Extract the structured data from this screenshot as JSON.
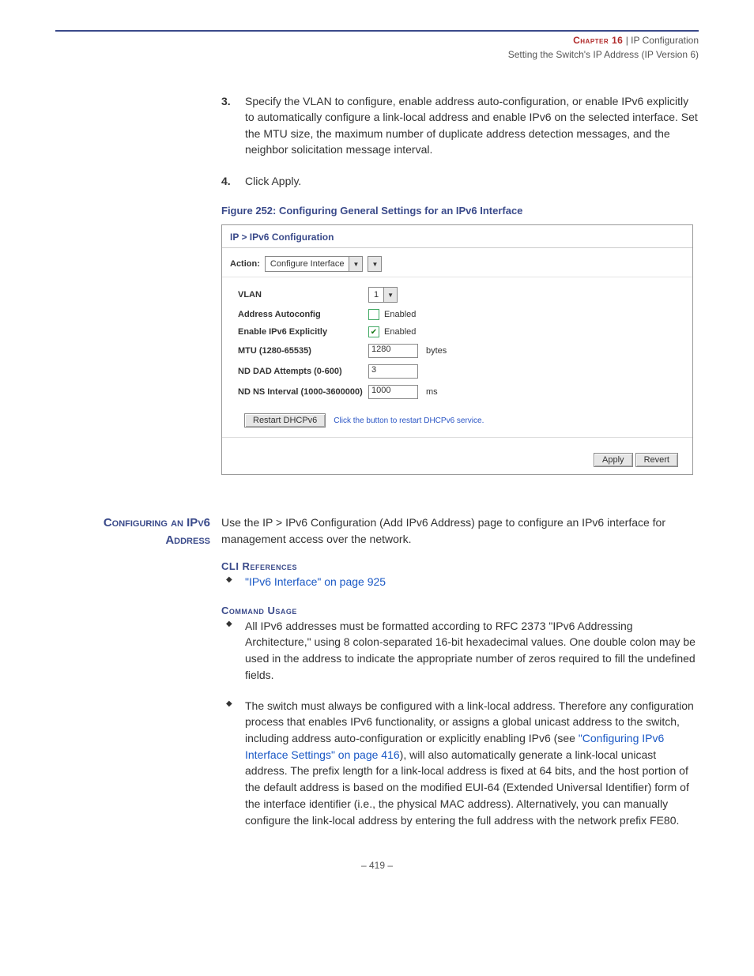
{
  "header": {
    "chapter_label": "Chapter 16",
    "separator": "  |  ",
    "chapter_title": "IP Configuration",
    "subtitle": "Setting the Switch's IP Address (IP Version 6)"
  },
  "steps": {
    "s3_num": "3.",
    "s3_text": "Specify the VLAN to configure, enable address auto-configuration, or enable IPv6 explicitly to automatically configure a link-local address and enable IPv6 on the selected interface. Set the MTU size, the maximum number of duplicate address detection messages, and the neighbor solicitation message interval.",
    "s4_num": "4.",
    "s4_text": "Click Apply."
  },
  "figure_caption": "Figure 252:  Configuring General Settings for an IPv6 Interface",
  "screenshot": {
    "title": "IP > IPv6 Configuration",
    "action_label": "Action:",
    "action_value": "Configure Interface",
    "fields": {
      "vlan_label": "VLAN",
      "vlan_value": "1",
      "autoconfig_label": "Address Autoconfig",
      "autoconfig_cb_label": "Enabled",
      "explicit_label": "Enable IPv6 Explicitly",
      "explicit_cb_label": "Enabled",
      "mtu_label": "MTU (1280-65535)",
      "mtu_value": "1280",
      "mtu_unit": "bytes",
      "dad_label": "ND DAD Attempts (0-600)",
      "dad_value": "3",
      "ns_label": "ND NS Interval (1000-3600000)",
      "ns_value": "1000",
      "ns_unit": "ms"
    },
    "restart_btn": "Restart DHCPv6",
    "restart_hint": "Click the button to restart DHCPv6 service.",
    "apply_btn": "Apply",
    "revert_btn": "Revert"
  },
  "section": {
    "side_l1": "Configuring an IPv6",
    "side_l2": "Address",
    "intro": "Use the IP > IPv6 Configuration (Add IPv6 Address) page to configure an IPv6 interface for management access over the network."
  },
  "cli": {
    "heading": "CLI References",
    "link": "\"IPv6 Interface\" on page 925"
  },
  "usage": {
    "heading": "Command Usage",
    "b1": "All IPv6 addresses must be formatted according to RFC 2373 \"IPv6 Addressing Architecture,\" using 8 colon-separated 16-bit hexadecimal values. One double colon may be used in the address to indicate the appropriate number of zeros required to fill the undefined fields.",
    "b2_a": "The switch must always be configured with a link-local address. Therefore any configuration process that enables IPv6 functionality, or assigns a global unicast address to the switch, including address auto-configuration or explicitly enabling IPv6 (see ",
    "b2_link": "\"Configuring IPv6 Interface Settings\" on page 416",
    "b2_b": "), will also automatically generate a link-local unicast address. The prefix length for a link-local address is fixed at 64 bits, and the host portion of the default address is based on the modified EUI-64 (Extended Universal Identifier) form of the interface identifier (i.e., the physical MAC address). Alternatively, you can manually configure the link-local address by entering the full address with the network prefix FE80."
  },
  "page_number": "–  419  –"
}
